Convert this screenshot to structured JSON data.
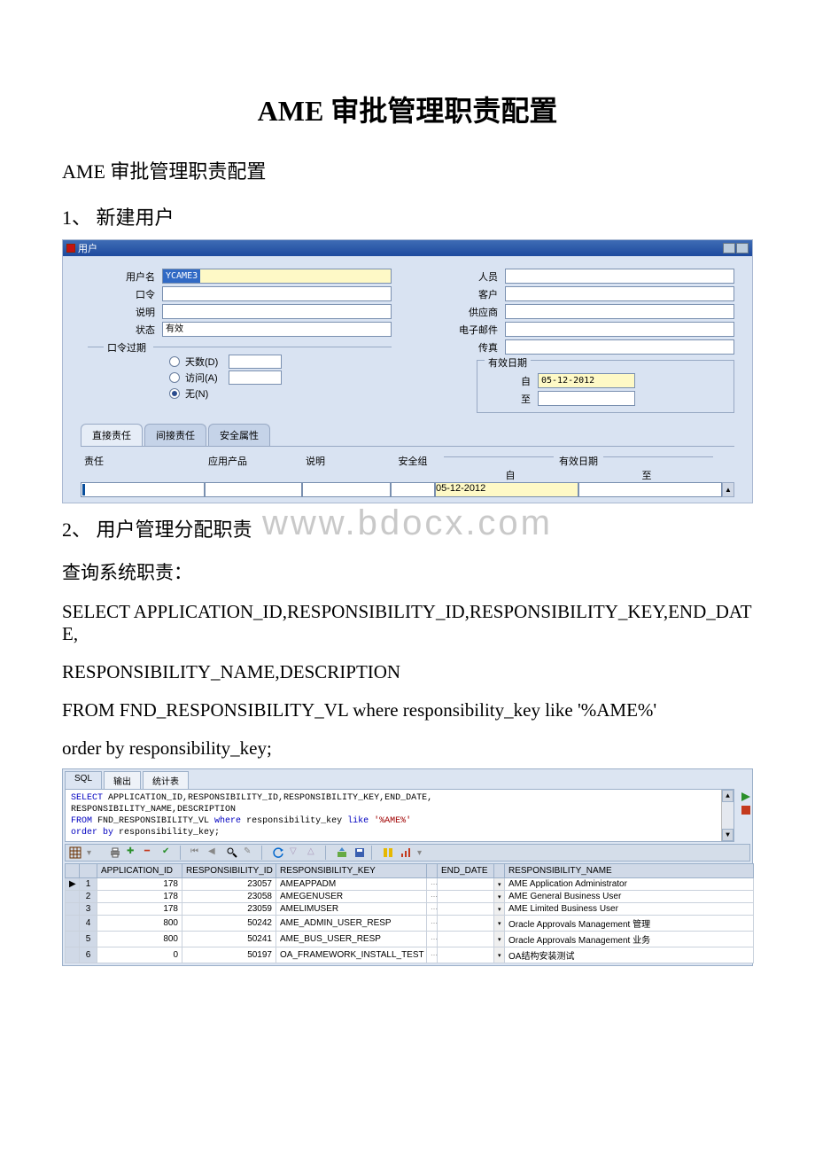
{
  "title": "AME 审批管理职责配置",
  "subtitle": "AME 审批管理职责配置",
  "section1": "1、 新建用户",
  "section2": "2、 用户管理分配职责",
  "para_query": " 查询系统职责：",
  "sql_text": {
    "line1": "       SELECT APPLICATION_ID,RESPONSIBILITY_ID,RESPONSIBILITY_KEY,END_DATE,",
    "line2": "        RESPONSIBILITY_NAME,DESCRIPTION",
    "line3": "       FROM FND_RESPONSIBILITY_VL where responsibility_key like '%AME%'",
    "line4": "       order by responsibility_key;"
  },
  "form": {
    "window_title": "用户",
    "labels": {
      "username": "用户名",
      "password": "口令",
      "desc": "说明",
      "status": "状态",
      "person": "人员",
      "customer": "客户",
      "supplier": "供应商",
      "email": "电子邮件",
      "fax": "传真",
      "pwd_expire": "口令过期",
      "days": "天数(D)",
      "visits": "访问(A)",
      "none": "无(N)",
      "effective": "有效日期",
      "from": "自",
      "to": "至"
    },
    "values": {
      "username": "YCAME3",
      "status": "有效",
      "eff_from": "05-12-2012"
    },
    "tabs": {
      "t1": "直接责任",
      "t2": "间接责任",
      "t3": "安全属性"
    },
    "grid_headers": {
      "resp": "责任",
      "app": "应用产品",
      "desc": "说明",
      "sec": "安全组",
      "eff": "有效日期",
      "from": "自",
      "to": "至"
    },
    "grid_row_from": "05-12-2012"
  },
  "watermark": "www.bdocx.com",
  "sqlpanel": {
    "tabs": {
      "sql": "SQL",
      "output": "输出",
      "stats": "统计表"
    },
    "code": {
      "l1a": "SELECT",
      "l1b": " APPLICATION_ID,RESPONSIBILITY_ID,RESPONSIBILITY_KEY,END_DATE,",
      "l2": "       RESPONSIBILITY_NAME,DESCRIPTION",
      "l3a": "FROM",
      "l3b": " FND_RESPONSIBILITY_VL ",
      "l3c": "where",
      "l3d": " responsibility_key ",
      "l3e": "like ",
      "l3f": "'%AME%'",
      "l4a": "  ",
      "l4b": "order by",
      "l4c": " responsibility_key;"
    },
    "headers": {
      "app_id": "APPLICATION_ID",
      "resp_id": "RESPONSIBILITY_ID",
      "resp_key": "RESPONSIBILITY_KEY",
      "end_date": "END_DATE",
      "resp_name": "RESPONSIBILITY_NAME"
    },
    "rows": [
      {
        "n": "1",
        "app": "178",
        "rid": "23057",
        "key": "AMEAPPADM",
        "end": "",
        "name": "AME Application Administrator",
        "cur": "▶"
      },
      {
        "n": "2",
        "app": "178",
        "rid": "23058",
        "key": "AMEGENUSER",
        "end": "",
        "name": "AME General Business User",
        "cur": ""
      },
      {
        "n": "3",
        "app": "178",
        "rid": "23059",
        "key": "AMELIMUSER",
        "end": "",
        "name": "AME Limited Business User",
        "cur": ""
      },
      {
        "n": "4",
        "app": "800",
        "rid": "50242",
        "key": "AME_ADMIN_USER_RESP",
        "end": "",
        "name": "Oracle Approvals Management 管理",
        "cur": ""
      },
      {
        "n": "5",
        "app": "800",
        "rid": "50241",
        "key": "AME_BUS_USER_RESP",
        "end": "",
        "name": "Oracle Approvals Management 业务",
        "cur": ""
      },
      {
        "n": "6",
        "app": "0",
        "rid": "50197",
        "key": "OA_FRAMEWORK_INSTALL_TEST",
        "end": "",
        "name": "OA结构安装测试",
        "cur": ""
      }
    ]
  }
}
